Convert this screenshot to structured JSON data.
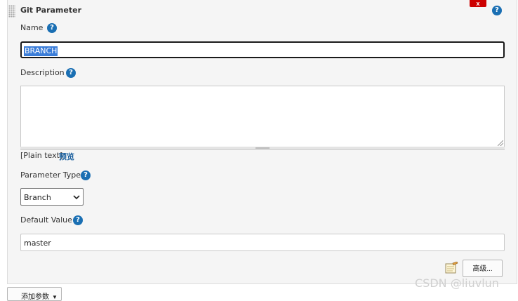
{
  "section": {
    "title": "Git Parameter",
    "delete_label": "x"
  },
  "help_glyph": "?",
  "fields": {
    "name": {
      "label": "Name",
      "value": "BRANCH"
    },
    "description": {
      "label": "Description",
      "value": ""
    },
    "plain_text_label": "[Plain text]",
    "preview_link": "预览",
    "parameter_type": {
      "label": "Parameter Type",
      "selected": "Branch"
    },
    "default_value": {
      "label": "Default Value",
      "value": "master"
    }
  },
  "buttons": {
    "advanced": "高级...",
    "add_parameter": "添加参数"
  },
  "watermark": "CSDN @liuvlun",
  "colors": {
    "help_icon": "#1a6fb3",
    "delete_button": "#cc0000",
    "selection": "#3b7dd8",
    "link": "#1a5f9e"
  },
  "icons": [
    "drag-handle-icon",
    "help-icon",
    "chevron-down-icon",
    "notepad-icon",
    "caret-down-icon"
  ]
}
